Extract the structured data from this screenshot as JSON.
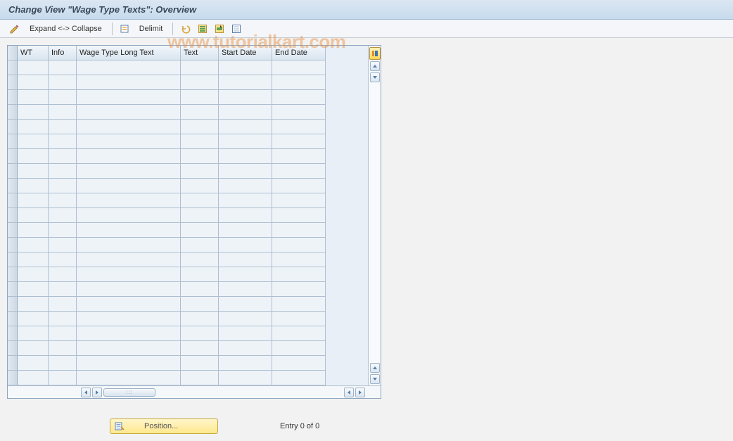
{
  "header": {
    "title": "Change View \"Wage Type Texts\": Overview"
  },
  "toolbar": {
    "expand_collapse": "Expand <-> Collapse",
    "delimit": "Delimit"
  },
  "table": {
    "columns": {
      "wt": "WT",
      "info": "Info",
      "long": "Wage Type Long Text",
      "text": "Text",
      "start": "Start Date",
      "end": "End Date"
    },
    "row_count": 22
  },
  "footer": {
    "position_label": "Position...",
    "entry_text": "Entry 0 of 0"
  },
  "watermark": "www.tutorialkart.com",
  "icons": {
    "pencil": "pencil-icon",
    "new_entries": "new-entries-icon",
    "copy": "copy-icon",
    "undo": "undo-icon",
    "select_all": "select-all-icon",
    "select_block": "select-block-icon",
    "deselect": "deselect-icon",
    "config": "table-settings-icon",
    "position": "position-icon"
  }
}
